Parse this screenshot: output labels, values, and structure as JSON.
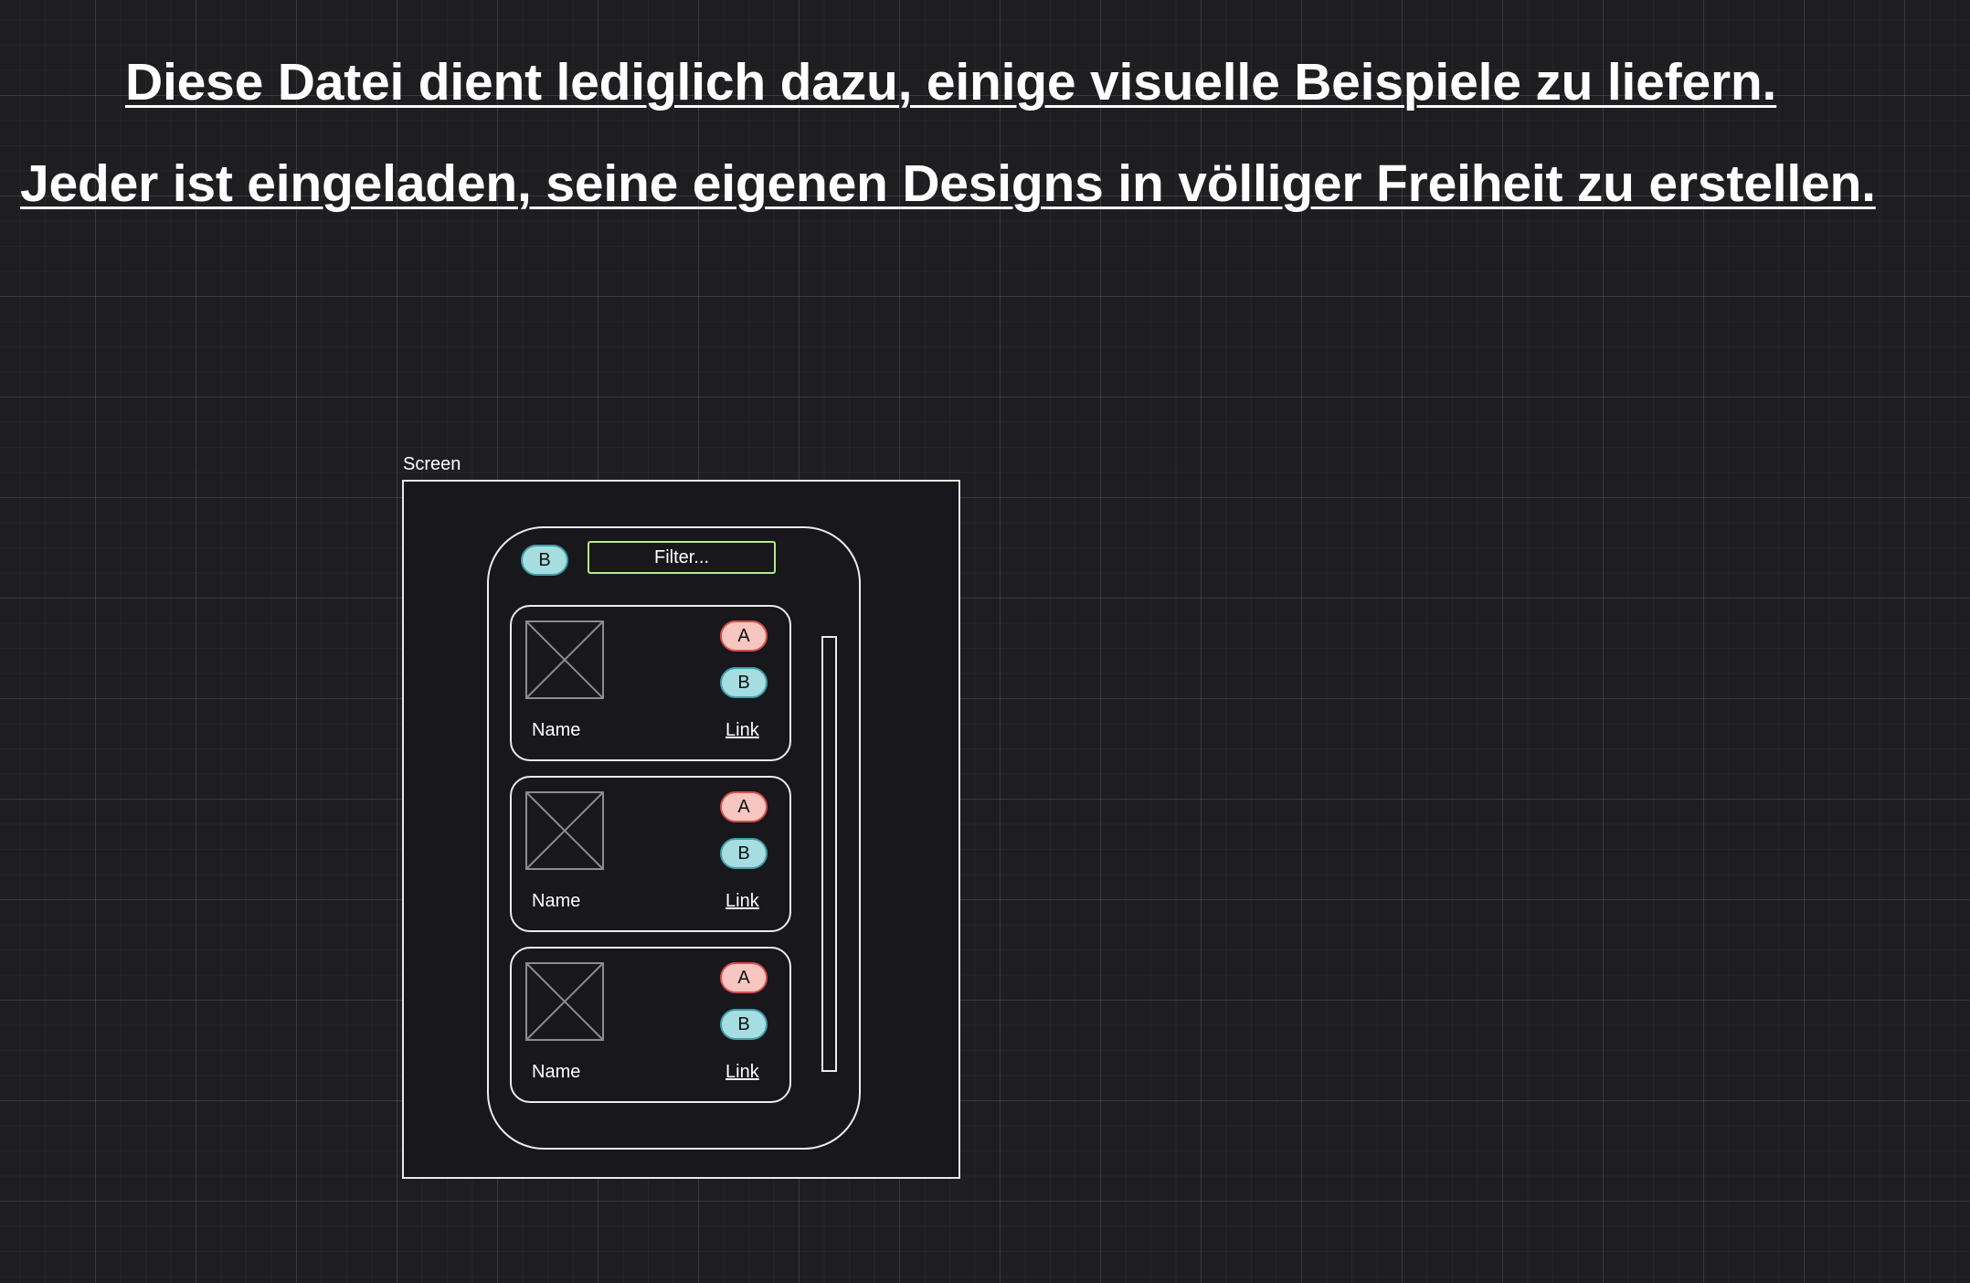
{
  "headings": [
    "Diese Datei dient lediglich dazu, einige visuelle Beispiele zu liefern.",
    "Jeder ist eingeladen, seine eigenen Designs in völliger Freiheit zu erstellen."
  ],
  "frame": {
    "label": "Screen"
  },
  "toolbar": {
    "badge_label": "B",
    "filter_placeholder": "Filter..."
  },
  "cards": [
    {
      "image_icon": "image-placeholder-icon",
      "badge_a": "A",
      "badge_b": "B",
      "name": "Name",
      "link": "Link"
    },
    {
      "image_icon": "image-placeholder-icon",
      "badge_a": "A",
      "badge_b": "B",
      "name": "Name",
      "link": "Link"
    },
    {
      "image_icon": "image-placeholder-icon",
      "badge_a": "A",
      "badge_b": "B",
      "name": "Name",
      "link": "Link"
    }
  ],
  "colors": {
    "background": "#1e1e21",
    "badge_a_fill": "#f7c6c0",
    "badge_a_stroke": "#d84e4e",
    "badge_b_fill": "#a5dde0",
    "badge_b_stroke": "#3f9da8",
    "filter_border": "#b8e986"
  }
}
